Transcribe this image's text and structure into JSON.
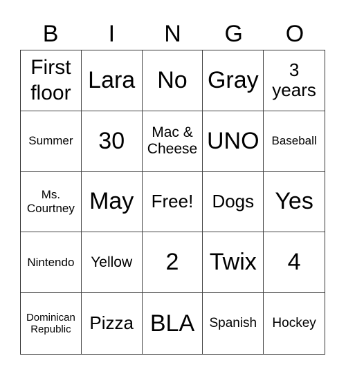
{
  "header": [
    "B",
    "I",
    "N",
    "G",
    "O"
  ],
  "cells": [
    [
      "First floor",
      "Lara",
      "No",
      "Gray",
      "3 years"
    ],
    [
      "Summer",
      "30",
      "Mac & Cheese",
      "UNO",
      "Baseball"
    ],
    [
      "Ms. Courtney",
      "May",
      "Free!",
      "Dogs",
      "Yes"
    ],
    [
      "Nintendo",
      "Yellow",
      "2",
      "Twix",
      "4"
    ],
    [
      "Dominican Republic",
      "Pizza",
      "BLA",
      "Spanish",
      "Hockey"
    ]
  ]
}
